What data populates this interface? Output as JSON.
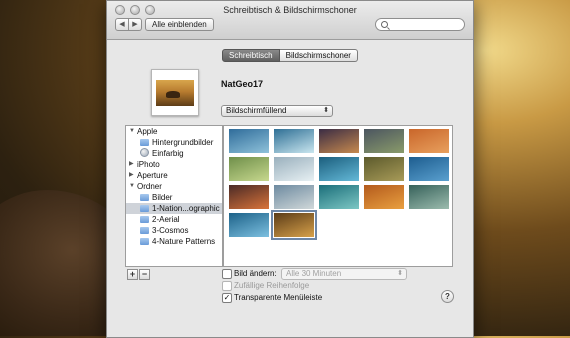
{
  "window": {
    "title": "Schreibtisch & Bildschirmschoner"
  },
  "toolbar": {
    "show_all_label": "Alle einblenden",
    "back_glyph": "◀",
    "forward_glyph": "▶"
  },
  "tabs": [
    {
      "label": "Schreibtisch",
      "active": true
    },
    {
      "label": "Bildschirmschoner",
      "active": false
    }
  ],
  "current": {
    "name": "NatGeo17",
    "fit_option": "Bildschirmfüllend"
  },
  "sidebar": {
    "items": [
      {
        "label": "Apple",
        "level": 0,
        "expanded": true,
        "icon": "apple-icon"
      },
      {
        "label": "Hintergrundbilder",
        "level": 1,
        "icon": "folder-icon"
      },
      {
        "label": "Einfarbig",
        "level": 1,
        "icon": "color-dot-icon"
      },
      {
        "label": "iPhoto",
        "level": 0,
        "expanded": false,
        "icon": "iphoto-icon"
      },
      {
        "label": "Aperture",
        "level": 0,
        "expanded": false,
        "icon": "aperture-icon"
      },
      {
        "label": "Ordner",
        "level": 0,
        "expanded": true,
        "icon": "folder-icon"
      },
      {
        "label": "Bilder",
        "level": 1,
        "icon": "folder-icon"
      },
      {
        "label": "1-Nation...ographic",
        "level": 1,
        "icon": "folder-icon",
        "selected": true
      },
      {
        "label": "2-Aerial",
        "level": 1,
        "icon": "folder-icon"
      },
      {
        "label": "3-Cosmos",
        "level": 1,
        "icon": "folder-icon"
      },
      {
        "label": "4-Nature Patterns",
        "level": 1,
        "icon": "folder-icon"
      }
    ]
  },
  "thumbnails": [
    {
      "c1": "#2f6c9a",
      "c2": "#8fc2da"
    },
    {
      "c1": "#2e6f95",
      "c2": "#c9e6ef"
    },
    {
      "c1": "#3a2c44",
      "c2": "#c78a4e"
    },
    {
      "c1": "#4b5560",
      "c2": "#8a9b6a"
    },
    {
      "c1": "#c9662a",
      "c2": "#e8a05e"
    },
    {
      "c1": "#6f8f4a",
      "c2": "#c7d88e"
    },
    {
      "c1": "#9ab0bd",
      "c2": "#e7f0f3"
    },
    {
      "c1": "#1b5e7d",
      "c2": "#64b9d8"
    },
    {
      "c1": "#5c5a2c",
      "c2": "#a89b58"
    },
    {
      "c1": "#1d5d8f",
      "c2": "#5aa0cf"
    },
    {
      "c1": "#4a2a26",
      "c2": "#d9743a"
    },
    {
      "c1": "#6d8aa0",
      "c2": "#d0d8d9"
    },
    {
      "c1": "#1b6e7a",
      "c2": "#7dc7c4"
    },
    {
      "c1": "#b35a1c",
      "c2": "#e9a040"
    },
    {
      "c1": "#36615a",
      "c2": "#9cbcae"
    },
    {
      "c1": "#1d6289",
      "c2": "#7dc0e0"
    },
    {
      "c1": "#5b3c18",
      "c2": "#d7a14a",
      "selected": true
    }
  ],
  "options": {
    "change_picture": {
      "label": "Bild ändern:",
      "checked": false
    },
    "interval": "Alle 30 Minuten",
    "random_order": {
      "label": "Zufällige Reihenfolge",
      "checked": false
    },
    "translucent_menu": {
      "label": "Transparente Menüleiste",
      "checked": true
    }
  },
  "buttons": {
    "add": "+",
    "remove": "−",
    "help": "?"
  }
}
